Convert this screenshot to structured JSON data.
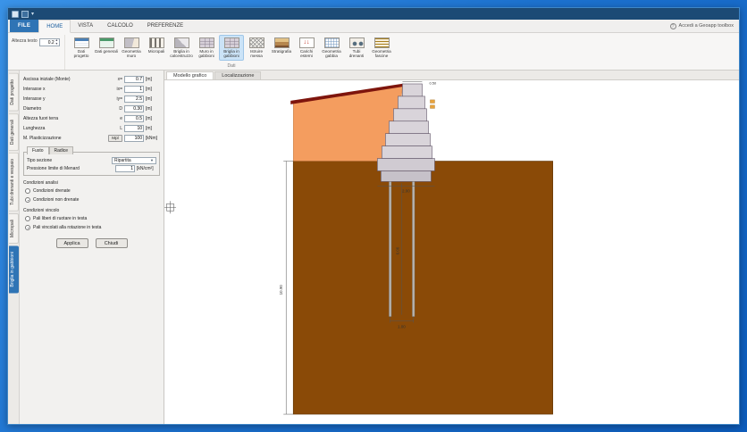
{
  "menu": {
    "file_tab": "FILE",
    "tabs": [
      "HOME",
      "VISTA",
      "CALCOLO",
      "PREFERENZE"
    ],
    "active_tab": "HOME",
    "geoapp_link": "Accedi a Geoapp toolbox"
  },
  "ribbon": {
    "text_height_label": "Altezza testo",
    "text_height_value": "0.2",
    "group_label": "Dati",
    "buttons": [
      {
        "label": "Dati progetto",
        "icon": "project-data-icon"
      },
      {
        "label": "Dati generali",
        "icon": "general-data-icon"
      },
      {
        "label": "Geometria muro",
        "icon": "wall-geometry-icon"
      },
      {
        "label": "Micropali",
        "icon": "micropiles-icon"
      },
      {
        "label": "Briglia in calcestruzzo",
        "icon": "concrete-weir-icon"
      },
      {
        "label": "Muro in gabbioni",
        "icon": "gabion-wall-icon"
      },
      {
        "label": "Briglia in gabbioni",
        "icon": "gabion-weir-icon",
        "active": true
      },
      {
        "label": "Istruire messa",
        "icon": "mesh-icon"
      },
      {
        "label": "Stratigrafia",
        "icon": "stratigraphy-icon"
      },
      {
        "label": "Carichi esterni",
        "icon": "external-loads-icon"
      },
      {
        "label": "Geometria gabbia",
        "icon": "cage-geometry-icon"
      },
      {
        "label": "Tubi drenanti",
        "icon": "drain-pipes-icon"
      },
      {
        "label": "Geometria fascine",
        "icon": "fascine-geometry-icon"
      }
    ]
  },
  "side_tabs": [
    {
      "label": "Dati progetto"
    },
    {
      "label": "Dati generali"
    },
    {
      "label": "Tubi drenanti e vespaio"
    },
    {
      "label": "Micropali"
    },
    {
      "label": "Briglia in gabbioni",
      "active": true
    }
  ],
  "panel": {
    "fields": [
      {
        "label": "Ascissa iniziale (Monte)",
        "code": "x=",
        "value": "0.7",
        "unit": "[m]"
      },
      {
        "label": "Interasse x",
        "code": "ix=",
        "value": "1",
        "unit": "[m]"
      },
      {
        "label": "Interasse y",
        "code": "iy=",
        "value": "2.5",
        "unit": "[m]"
      },
      {
        "label": "Diametro",
        "code": "D",
        "value": "0.30",
        "unit": "[m]"
      },
      {
        "label": "Altezza fuori terra",
        "code": "e",
        "value": "0.5",
        "unit": "[m]"
      },
      {
        "label": "Lunghezza",
        "code": "L",
        "value": "10",
        "unit": "[m]"
      }
    ],
    "plastic_moment": {
      "label": "M. Plasticizzazione",
      "button": "Mpl",
      "value": "100",
      "unit": "[kNm]"
    },
    "section_box": {
      "tabs": [
        "Fusto",
        "Radice"
      ],
      "active_tab": "Fusto",
      "tipo_label": "Tipo sezione",
      "tipo_value": "Ripartita",
      "pressure_label": "Pressione limite di Menard",
      "pressure_value": "1",
      "pressure_unit": "[kN/cm²]"
    },
    "analysis": {
      "title": "Condizioni analisi",
      "options": [
        {
          "label": "Condizioni drenate",
          "selected": false
        },
        {
          "label": "Condizioni non drenate",
          "selected": true
        }
      ]
    },
    "constraint": {
      "title": "Condizioni vincolo",
      "options": [
        {
          "label": "Pali liberi di ruotare in testa",
          "selected": false
        },
        {
          "label": "Pali vincolati alla rotazione in testa",
          "selected": true
        }
      ]
    },
    "apply_button": "Applica",
    "close_button": "Chiudi"
  },
  "canvas": {
    "tabs": [
      "Modello grafico",
      "Localizzazione"
    ],
    "active_tab": "Modello grafico",
    "dims": {
      "total_height": "10.90",
      "top_width": "0.50",
      "base_width": "2.00",
      "pile_length": "6.00",
      "pile_spacing": "1.00"
    },
    "colors": {
      "soil": "#8a4a07",
      "backfill": "#f49d5f",
      "gabion": "#d9d4da",
      "cap": "#7e150d",
      "pile": "#b8b4ae",
      "accent_blue": "#2f74b5"
    }
  }
}
